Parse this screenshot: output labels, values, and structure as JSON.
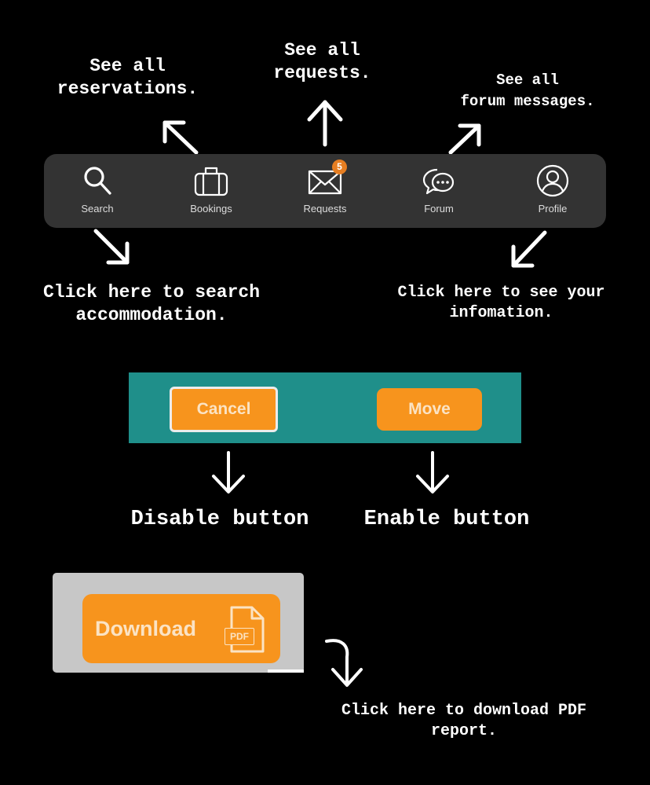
{
  "annotations": {
    "reservations": [
      "See all",
      "reservations."
    ],
    "requests": [
      "See all",
      "requests."
    ],
    "forum": [
      "See all",
      "forum messages."
    ],
    "search": [
      "Click here to search",
      "accommodation."
    ],
    "profile": [
      "Click here to see your",
      "infomation."
    ],
    "disable": "Disable button",
    "enable": "Enable button",
    "download": [
      "Click here to download PDF",
      "report."
    ]
  },
  "navbar": {
    "items": [
      {
        "label": "Search",
        "icon": "search-icon"
      },
      {
        "label": "Bookings",
        "icon": "briefcase-icon"
      },
      {
        "label": "Requests",
        "icon": "envelope-icon",
        "badge": "5"
      },
      {
        "label": "Forum",
        "icon": "chat-bubble-icon"
      },
      {
        "label": "Profile",
        "icon": "user-circle-icon"
      }
    ]
  },
  "buttons": {
    "cancel_label": "Cancel",
    "move_label": "Move",
    "download_label": "Download",
    "pdf_label": "PDF"
  },
  "colors": {
    "background": "#000000",
    "navbar": "#333333",
    "teal_panel": "#1f8f8a",
    "orange": "#f7941d",
    "badge": "#e67e22",
    "download_panel": "#c7c7c7"
  }
}
